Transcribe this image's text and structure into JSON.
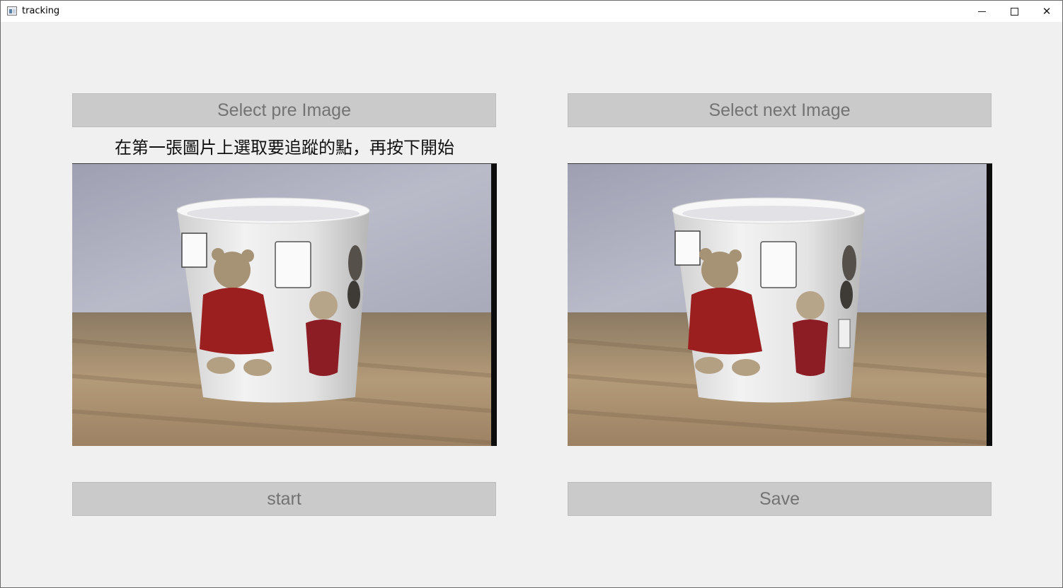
{
  "window": {
    "title": "tracking"
  },
  "buttons": {
    "select_pre": "Select pre Image",
    "select_next": "Select next Image",
    "start": "start",
    "save": "Save"
  },
  "instruction": "在第一張圖片上選取要追蹤的點，再按下開始",
  "images": {
    "pre": {
      "description_icon": "cup-with-teddy-bears-photo"
    },
    "next": {
      "description_icon": "cup-with-teddy-bears-photo"
    }
  },
  "colors": {
    "button_bg": "#cacaca",
    "button_text": "#737373",
    "window_bg": "#f0f0f0"
  }
}
